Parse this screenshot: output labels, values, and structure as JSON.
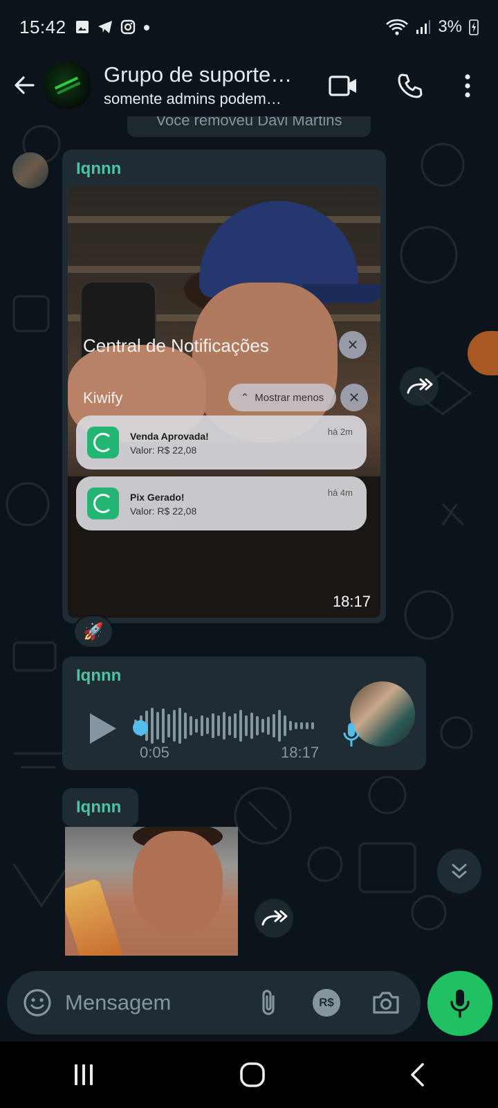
{
  "status_bar": {
    "time": "15:42",
    "battery": "3%"
  },
  "header": {
    "title": "Grupo de suporte…",
    "subtitle": "somente admins podem…"
  },
  "chat": {
    "system_message": "Você removeu Davi Martins",
    "image_message": {
      "sender": "Iqnnn",
      "time": "18:17",
      "overlay": {
        "title": "Central de Notificações",
        "app": "Kiwify",
        "toggle_label": "Mostrar menos",
        "cards": [
          {
            "heading": "Venda Aprovada!",
            "value": "Valor: R$ 22,08",
            "age": "há 2m"
          },
          {
            "heading": "Pix Gerado!",
            "value": "Valor: R$ 22,08",
            "age": "há 4m"
          }
        ]
      },
      "reaction": "🚀"
    },
    "audio_message": {
      "sender": "Iqnnn",
      "duration": "0:05",
      "time": "18:17"
    },
    "sticker_message": {
      "sender": "Iqnnn"
    }
  },
  "composer": {
    "placeholder": "Mensagem",
    "payment_label": "R$"
  },
  "colors": {
    "background": "#0b141a",
    "bubble": "#1f2c34",
    "accent_green": "#21c063",
    "sender_teal": "#4fc3a1",
    "audio_dot": "#53bdeb"
  }
}
